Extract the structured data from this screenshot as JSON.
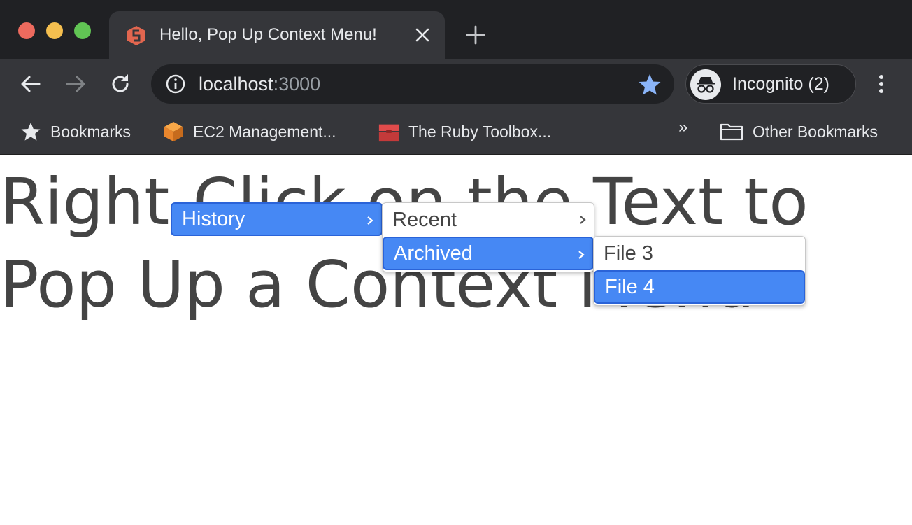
{
  "tab": {
    "title": "Hello, Pop Up Context Menu!"
  },
  "address_bar": {
    "host": "localhost",
    "port": ":3000"
  },
  "profile": {
    "label": "Incognito (2)"
  },
  "bookmarks": {
    "items": [
      {
        "label": "Bookmarks",
        "icon": "star-icon"
      },
      {
        "label": "EC2 Management...",
        "icon": "aws-cube-icon"
      },
      {
        "label": "The Ruby Toolbox...",
        "icon": "toolbox-icon"
      }
    ],
    "overflow": "»",
    "other": {
      "label": "Other Bookmarks",
      "icon": "folder-icon"
    }
  },
  "page": {
    "heading_line1": "Right-Click on the Text to",
    "heading_line2": "Pop Up a Context Menu"
  },
  "context_menu": {
    "level1": [
      {
        "label": "History",
        "has_submenu": true,
        "active": true
      }
    ],
    "level2": [
      {
        "label": "Recent",
        "has_submenu": true,
        "active": false
      },
      {
        "label": "Archived",
        "has_submenu": true,
        "active": true
      }
    ],
    "level3": [
      {
        "label": "File 3",
        "active": false
      },
      {
        "label": "File 4",
        "active": true
      }
    ]
  },
  "colors": {
    "accent": "#4688f4",
    "chrome_dark": "#202124",
    "chrome_tab": "#35363a",
    "text": "#444444",
    "star": "#8ab4f8"
  }
}
